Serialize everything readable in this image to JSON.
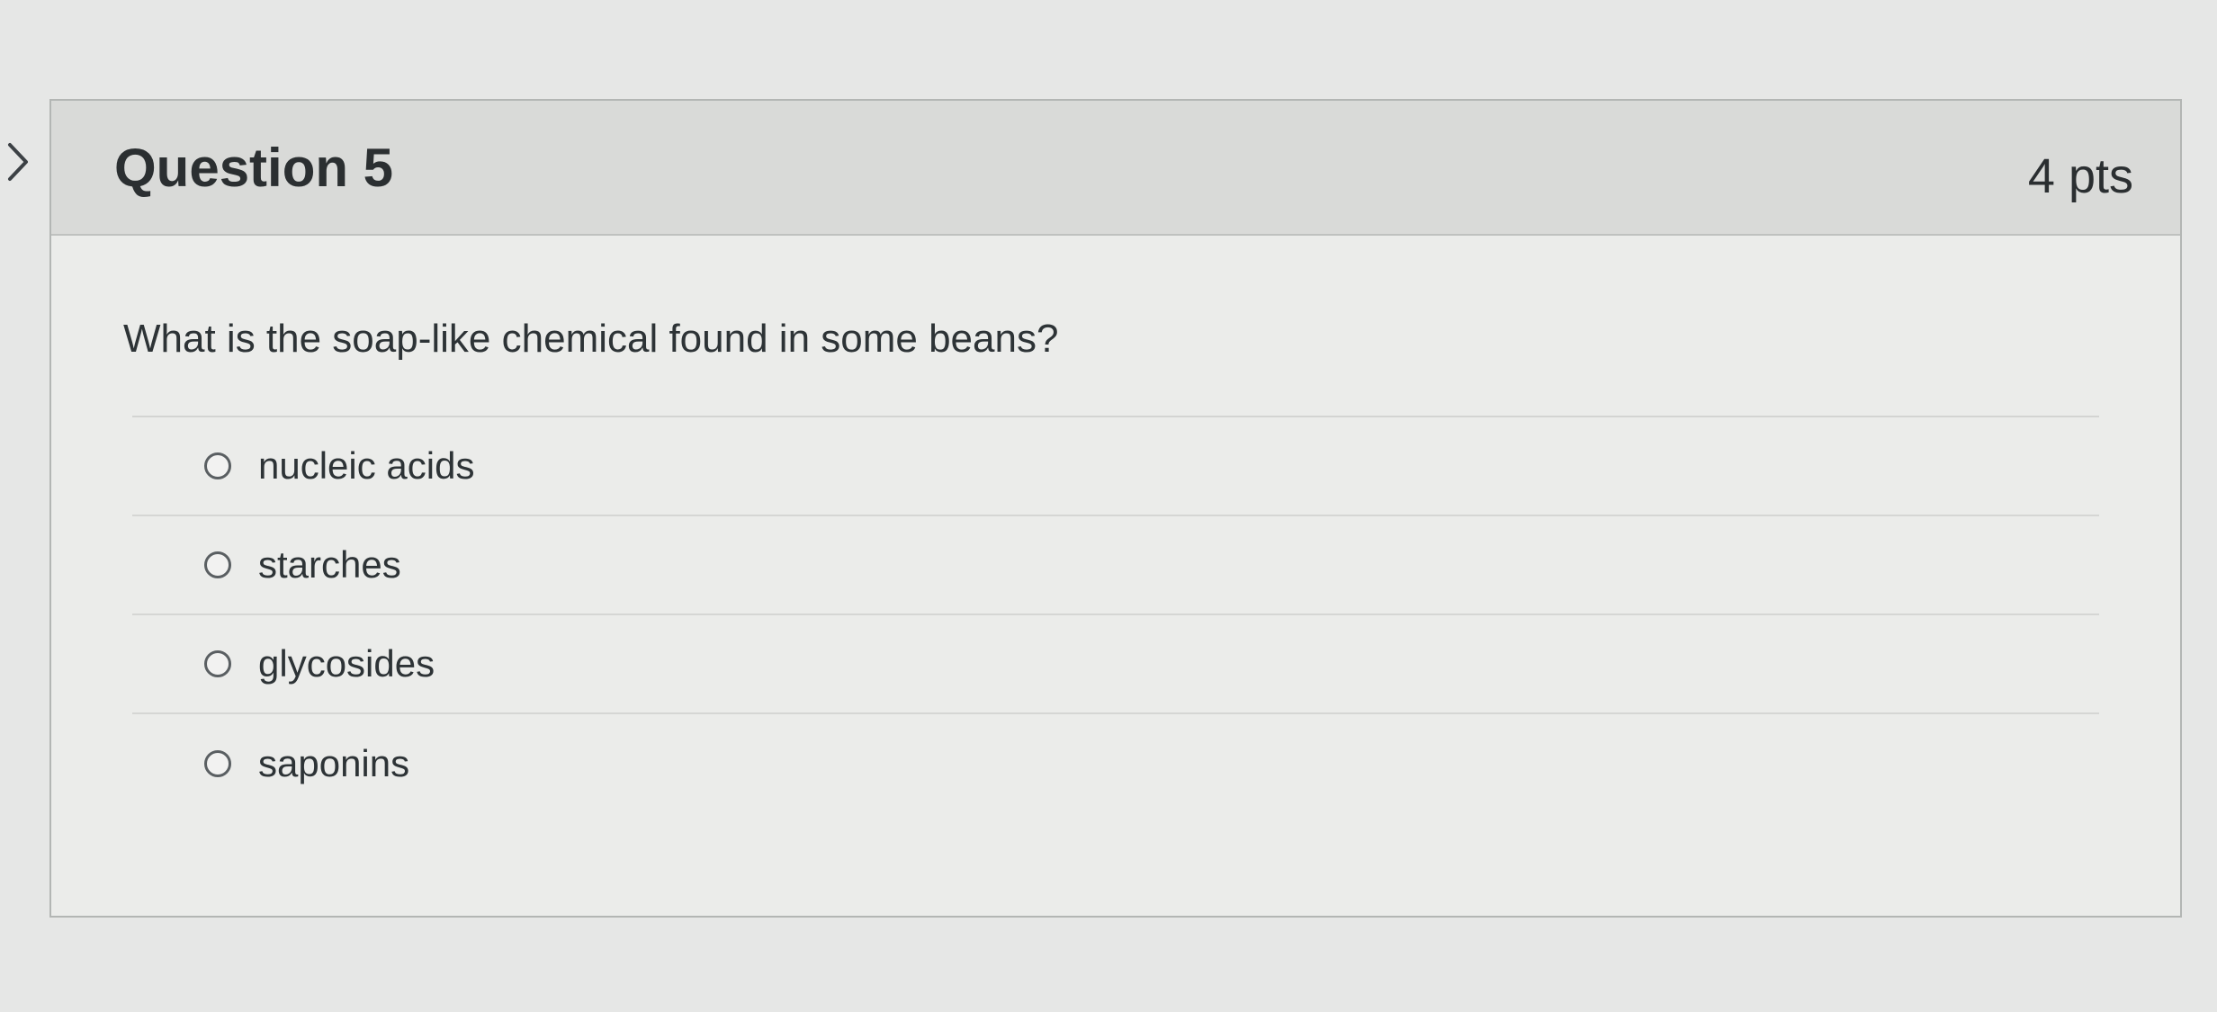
{
  "question": {
    "title": "Question 5",
    "points": "4 pts",
    "text": "What is the soap-like chemical found in some beans?",
    "answers": [
      {
        "label": "nucleic acids"
      },
      {
        "label": "starches"
      },
      {
        "label": "glycosides"
      },
      {
        "label": "saponins"
      }
    ]
  },
  "icons": {
    "expand": "chevron-right-icon",
    "option": "radio-circle-icon"
  },
  "colors": {
    "header_bg": "#d9dad8",
    "card_bg": "#ebecea",
    "text": "#2d3336"
  }
}
